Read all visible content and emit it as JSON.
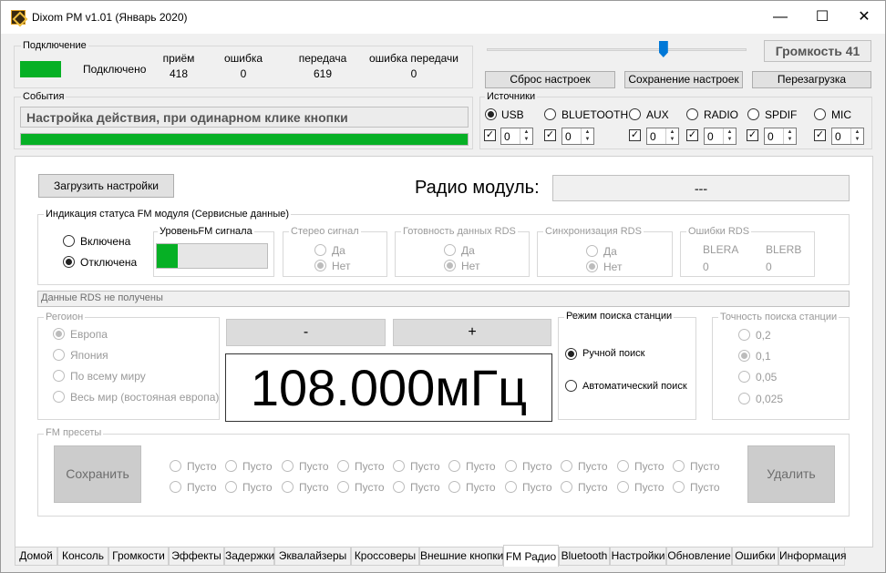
{
  "window": {
    "title": "Dixom PM v1.01 (Январь 2020)",
    "minimize": "—",
    "maximize": "☐",
    "close": "✕"
  },
  "connection": {
    "group": "Подключение",
    "status": "Подключено",
    "status_color": "#06b025",
    "stats": [
      {
        "label": "приём",
        "value": "418"
      },
      {
        "label": "ошибка",
        "value": "0"
      },
      {
        "label": "передача",
        "value": "619"
      },
      {
        "label": "ошибка передачи",
        "value": "0"
      }
    ]
  },
  "events": {
    "group": "События",
    "text": "Настройка действия, при одинарном клике кнопки",
    "progress": 1.0
  },
  "top_controls": {
    "volume_slider": 0.68,
    "volume_label": "Громкость 41",
    "reset_button": "Сброс настроек",
    "save_button": "Сохранение настроек",
    "reboot_button": "Перезагрузка"
  },
  "sources": {
    "group": "Источники",
    "items": [
      {
        "label": "USB",
        "selected": true,
        "checked": true,
        "value": "0"
      },
      {
        "label": "BLUETOOTH",
        "selected": false,
        "checked": true,
        "value": "0"
      },
      {
        "label": "AUX",
        "selected": false,
        "checked": true,
        "value": "0"
      },
      {
        "label": "RADIO",
        "selected": false,
        "checked": true,
        "value": "0"
      },
      {
        "label": "SPDIF",
        "selected": false,
        "checked": true,
        "value": "0"
      },
      {
        "label": "MIC",
        "selected": false,
        "checked": true,
        "value": "0"
      }
    ]
  },
  "radio": {
    "load_button": "Загрузить настройки",
    "module_label": "Радио модуль:",
    "module_value": "---",
    "status_group": "Индикация статуса FM модуля (Сервисные данные)",
    "ind_on": "Включена",
    "ind_off": "Отключена",
    "signal_group": "УровеньFM сигнала",
    "signal_level": 0.19,
    "stereo_group": "Стерео сигнал",
    "rds_ready_group": "Готовность данных RDS",
    "rds_sync_group": "Синхронизация RDS",
    "yes": "Да",
    "no": "Нет",
    "rds_errors_group": "Ошибки RDS",
    "blera": "BLERA",
    "blerb": "BLERB",
    "blera_value": "0",
    "blerb_value": "0",
    "rds_data": "Данные RDS не получены",
    "region_group": "Регоион",
    "regions": [
      "Европа",
      "Япония",
      "По всему миру",
      "Весь мир (востояная европа)"
    ],
    "minus": "-",
    "plus": "+",
    "frequency": "108.000мГц",
    "search_group": "Режим поиска станции",
    "search_manual": "Ручной поиск",
    "search_auto": "Автоматический поиск",
    "accuracy_group": "Точность поиска станции",
    "accuracy": [
      "0,2",
      "0,1",
      "0,05",
      "0,025"
    ],
    "presets_group": "FM пресеты",
    "save_preset": "Сохранить",
    "delete_preset": "Удалить",
    "preset_label": "Пусто"
  },
  "tabs": [
    "Домой",
    "Консоль",
    "Громкости",
    "Эффекты",
    "Задержки",
    "Эквалайзеры",
    "Кроссоверы",
    "Внешние кнопки",
    "FM Радио",
    "Bluetooth",
    "Настройки",
    "Обновление",
    "Ошибки",
    "Информация"
  ],
  "active_tab": "FM Радио"
}
